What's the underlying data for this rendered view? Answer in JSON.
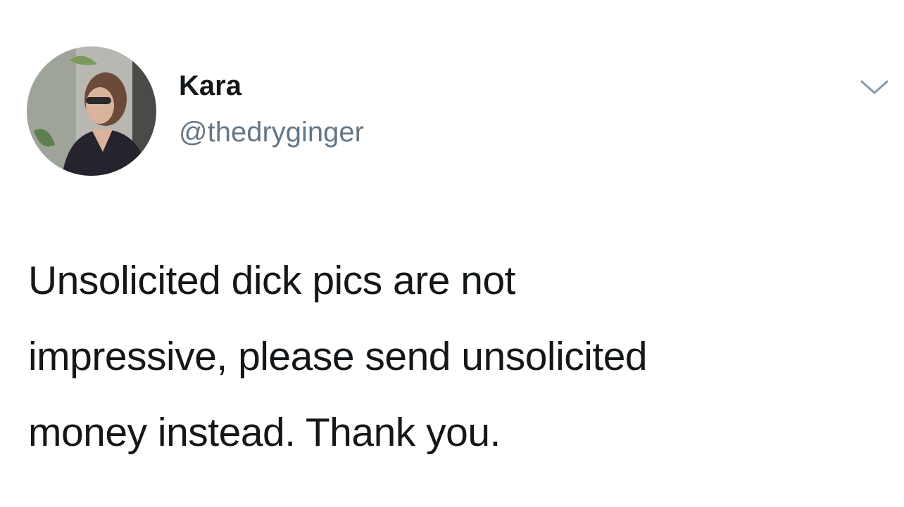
{
  "author": {
    "display_name": "Kara",
    "handle": "@thedryginger",
    "avatar_icon": "profile-photo"
  },
  "menu": {
    "caret_icon": "chevron-down-icon"
  },
  "tweet": {
    "lines": [
      "Unsolicited dick pics are not",
      "impressive, please send unsolicited",
      "money instead. Thank you."
    ]
  },
  "colors": {
    "text": "#14171a",
    "secondary": "#657786",
    "background": "#ffffff"
  }
}
